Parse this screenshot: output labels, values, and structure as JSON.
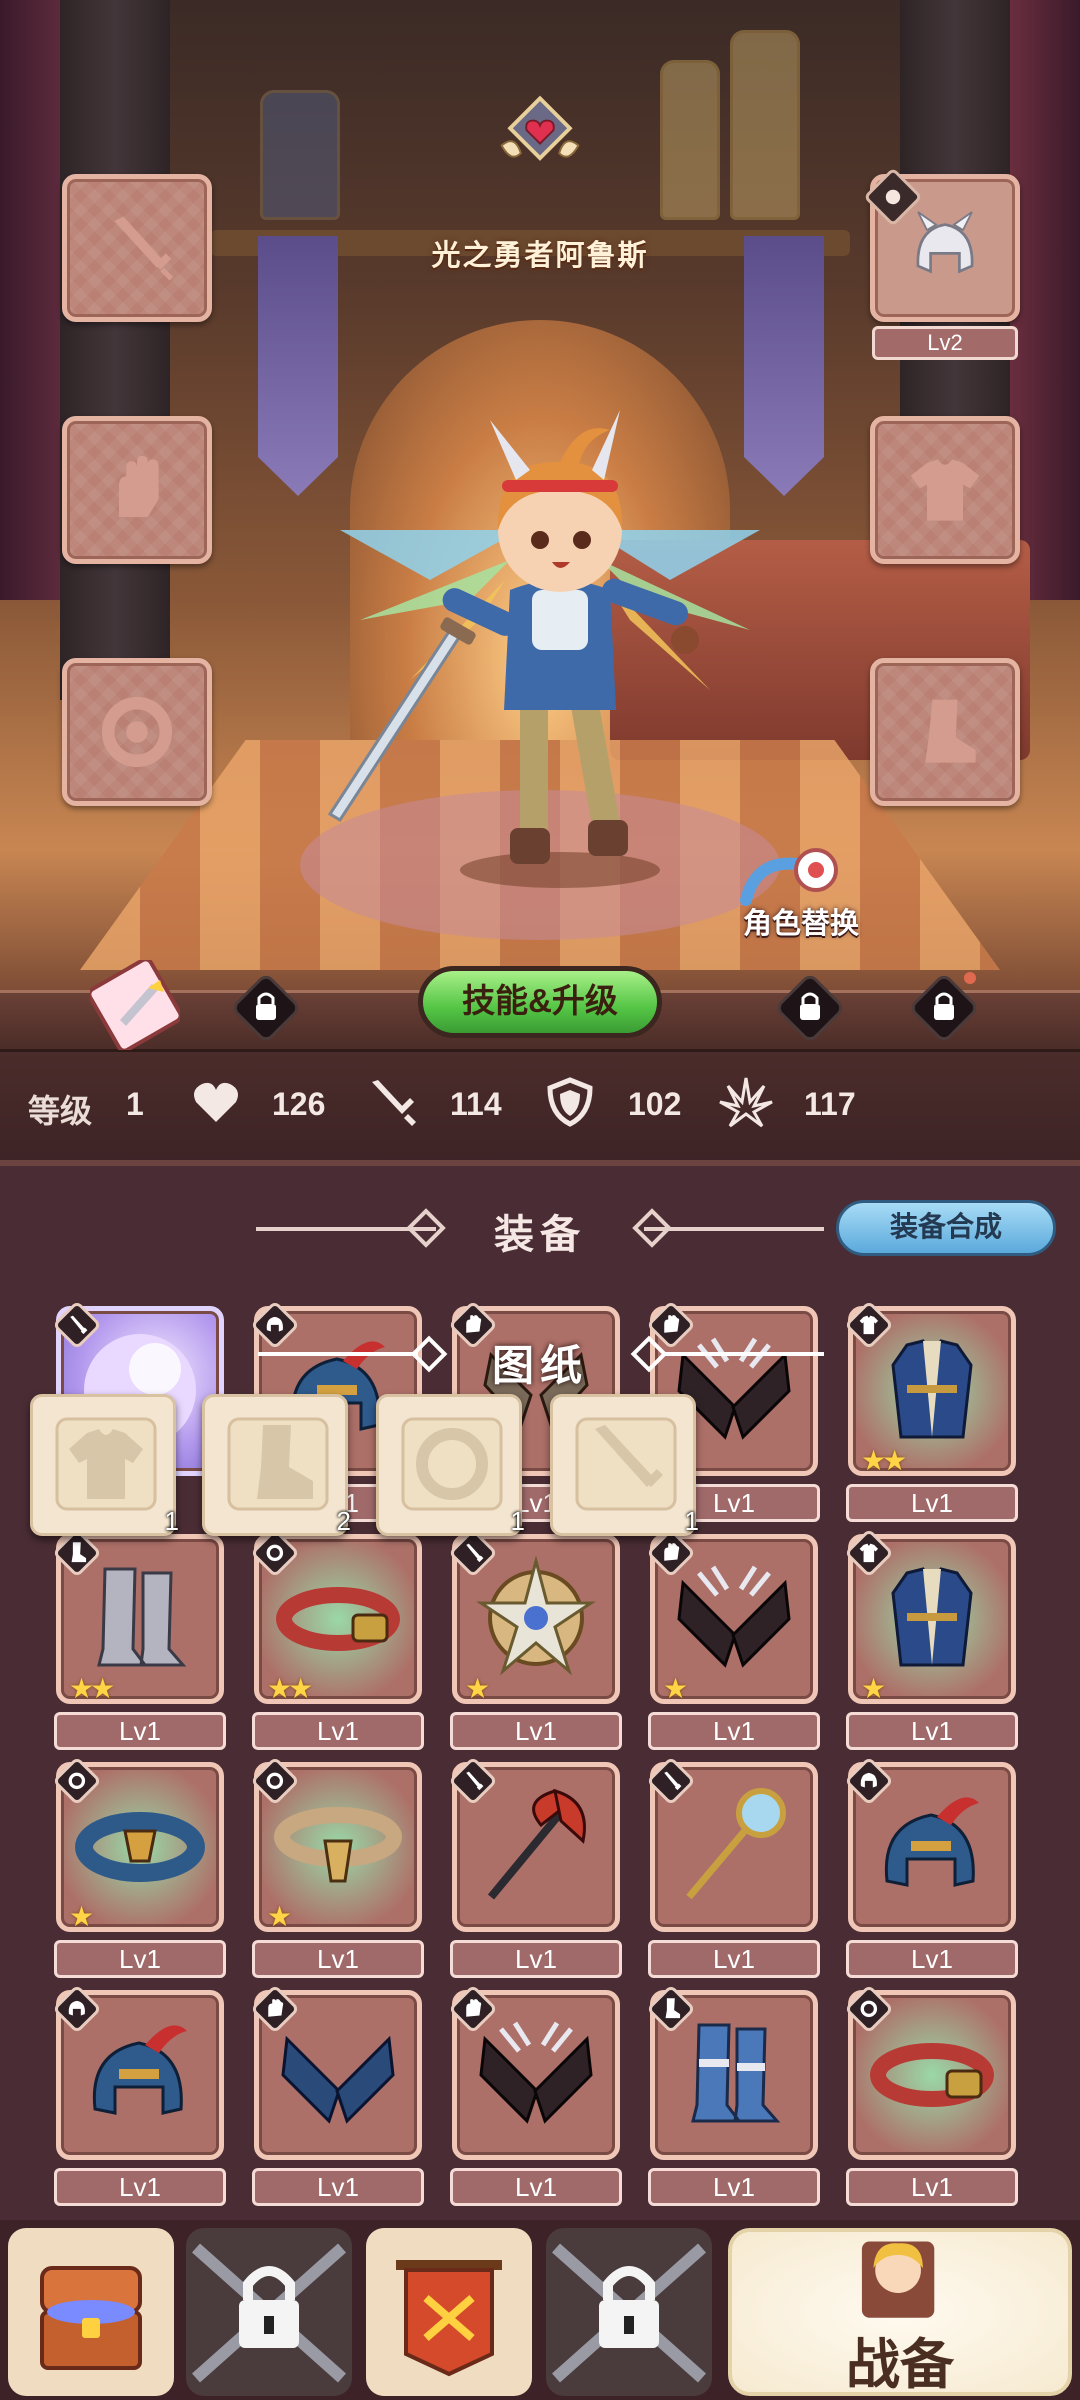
{
  "hero": {
    "name": "光之勇者阿鲁斯",
    "swap_label": "角色替换"
  },
  "hero_slots": {
    "helmet_level": "Lv2"
  },
  "action_bar": {
    "skill_button": "技能&升级"
  },
  "stats": {
    "level_label": "等级",
    "level": "1",
    "hp": "126",
    "attack": "114",
    "defense": "102",
    "crit": "117"
  },
  "equipment": {
    "title": "装备",
    "synth_button": "装备合成",
    "items": [
      {
        "level": "",
        "stars": 0,
        "type": "weapon",
        "icon": "magic-orb-icon"
      },
      {
        "level": "Lv1",
        "stars": 0,
        "type": "helmet",
        "icon": "plumed-helmet-icon"
      },
      {
        "level": "Lv1",
        "stars": 0,
        "type": "gloves",
        "icon": "gauntlets-icon"
      },
      {
        "level": "Lv1",
        "stars": 1,
        "type": "gloves",
        "icon": "claw-gauntlets-icon"
      },
      {
        "level": "Lv1",
        "stars": 2,
        "type": "armor",
        "icon": "blue-coat-icon"
      },
      {
        "level": "Lv1",
        "stars": 2,
        "type": "boots",
        "icon": "steel-boots-icon"
      },
      {
        "level": "Lv1",
        "stars": 2,
        "type": "accessory",
        "icon": "red-belt-icon"
      },
      {
        "level": "Lv1",
        "stars": 1,
        "type": "weapon",
        "icon": "star-shield-icon"
      },
      {
        "level": "Lv1",
        "stars": 1,
        "type": "gloves",
        "icon": "claw-gauntlets-icon"
      },
      {
        "level": "Lv1",
        "stars": 1,
        "type": "armor",
        "icon": "blue-coat-icon"
      },
      {
        "level": "Lv1",
        "stars": 1,
        "type": "accessory",
        "icon": "blue-belt-icon"
      },
      {
        "level": "Lv1",
        "stars": 1,
        "type": "accessory",
        "icon": "gold-belt-icon"
      },
      {
        "level": "Lv1",
        "stars": 0,
        "type": "weapon",
        "icon": "battle-axe-icon"
      },
      {
        "level": "Lv1",
        "stars": 0,
        "type": "weapon",
        "icon": "magic-staff-icon"
      },
      {
        "level": "Lv1",
        "stars": 0,
        "type": "helmet",
        "icon": "plumed-helmet-icon"
      },
      {
        "level": "Lv1",
        "stars": 0,
        "type": "helmet",
        "icon": "plumed-helmet-icon"
      },
      {
        "level": "Lv1",
        "stars": 0,
        "type": "gloves",
        "icon": "blue-gauntlets-icon"
      },
      {
        "level": "Lv1",
        "stars": 0,
        "type": "gloves",
        "icon": "claw-gauntlets-icon"
      },
      {
        "level": "Lv1",
        "stars": 0,
        "type": "boots",
        "icon": "blue-boots-icon"
      },
      {
        "level": "Lv1",
        "stars": 0,
        "type": "accessory",
        "icon": "red-belt-icon"
      }
    ]
  },
  "blueprints": {
    "title": "图纸",
    "items": [
      {
        "type": "armor",
        "count": "1"
      },
      {
        "type": "boots",
        "count": "2"
      },
      {
        "type": "accessory",
        "count": "1"
      },
      {
        "type": "weapon",
        "count": "1"
      }
    ]
  },
  "nav": {
    "main_label": "战备",
    "tiles": [
      "treasure-chest-icon",
      "lock-icon",
      "guild-banner-icon",
      "lock-icon"
    ]
  },
  "colors": {
    "panel_bg": "#4a2d34",
    "card_border": "#f0c7b6",
    "star": "#ffd447",
    "skill_button": "#54c545",
    "synth_button": "#5ba9dc"
  }
}
